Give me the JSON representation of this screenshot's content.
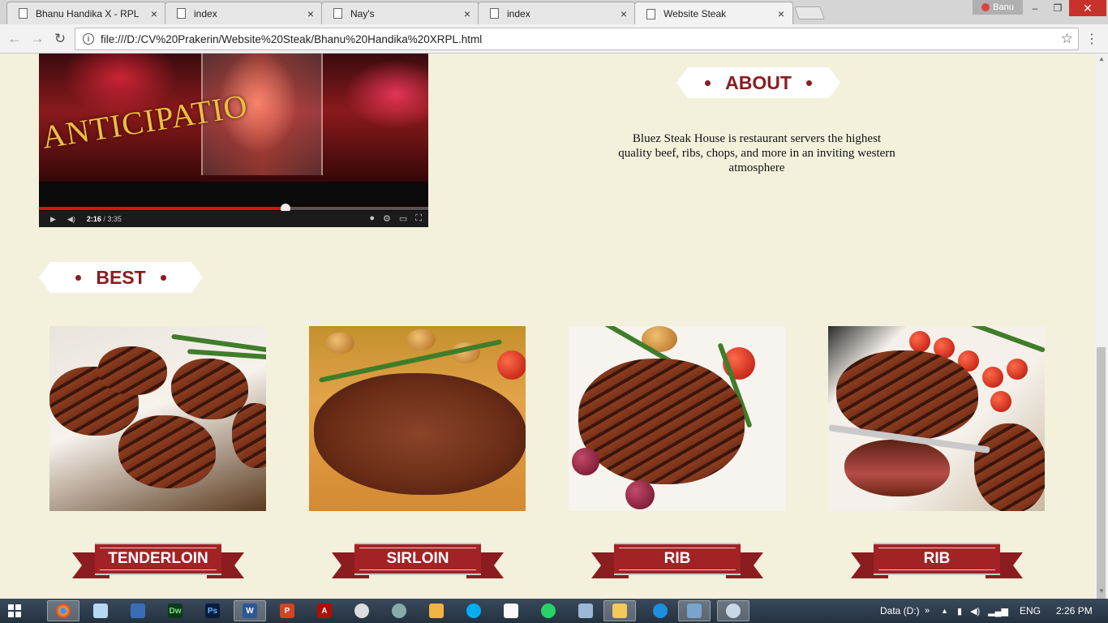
{
  "browser": {
    "tabs": [
      {
        "title": "Bhanu Handika X - RPL",
        "active": false
      },
      {
        "title": "index",
        "active": false
      },
      {
        "title": "Nay's",
        "active": false
      },
      {
        "title": "index",
        "active": false
      },
      {
        "title": "Website Steak",
        "active": true
      }
    ],
    "tab_close_glyph": "×",
    "user_name": "Banu",
    "window_controls": {
      "minimize": "–",
      "maximize": "❐",
      "close": "✕"
    },
    "nav": {
      "back": "←",
      "forward": "→",
      "reload": "↻"
    },
    "url": "file:///D:/CV%20Prakerin/Website%20Steak/Bhanu%20Handika%20XRPL.html",
    "star_glyph": "☆",
    "menu_glyph": "⋮"
  },
  "video": {
    "overlay_text": "ANTICIPATIO",
    "current_time": "2:16",
    "duration": "/ 3:35",
    "progress": 0.633,
    "icons": [
      "play-icon",
      "volume-icon",
      "settings-icon",
      "theater-icon",
      "fullscreen-icon"
    ]
  },
  "about": {
    "heading": "ABOUT",
    "text": "Bluez Steak House is restaurant servers the highest quality beef, ribs, chops, and more in an inviting western atmosphere"
  },
  "best": {
    "heading": "BEST",
    "items": [
      {
        "label": "TENDERLOIN"
      },
      {
        "label": "SIRLOIN"
      },
      {
        "label": "RIB"
      },
      {
        "label": "RIB"
      }
    ]
  },
  "colors": {
    "page_bg": "#f3f1dc",
    "accent": "#8a1c1f",
    "ribbon_red": "#a32226"
  },
  "taskbar": {
    "apps": [
      "chrome-icon",
      "notepad-icon",
      "virtualbox-icon",
      "dreamweaver-icon",
      "photoshop-icon",
      "word-icon",
      "powerpoint-icon",
      "acrobat-icon",
      "media-icon",
      "browser-icon",
      "folder-icon",
      "skype-icon",
      "document-icon",
      "whatsapp-icon",
      "monitor-icon",
      "explorer-icon",
      "ie-icon",
      "photo-viewer-icon",
      "paint-icon"
    ],
    "app_glyphs": {
      "dw": "Dw",
      "ps": "Ps",
      "word": "W",
      "ppt": "P",
      "acrobat": "A"
    },
    "drive_label": "Data (D:)",
    "language": "ENG",
    "time": "2:26 PM"
  }
}
